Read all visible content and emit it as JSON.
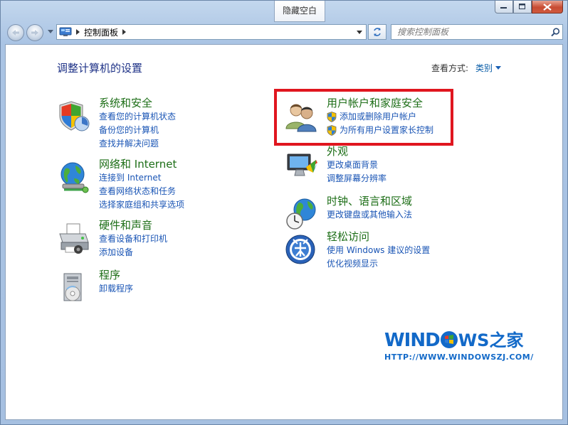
{
  "window": {
    "tooltip": "隐藏空白",
    "buttons": [
      "minimize",
      "maximize",
      "close"
    ]
  },
  "toolbar": {
    "breadcrumb": "控制面板",
    "search_placeholder": "搜索控制面板"
  },
  "main": {
    "title": "调整计算机的设置",
    "view_by_label": "查看方式:",
    "view_by_value": "类别"
  },
  "categories": [
    {
      "title": "系统和安全",
      "icon": "shield-icon",
      "links": [
        "查看您的计算机状态",
        "备份您的计算机",
        "查找并解决问题"
      ]
    },
    {
      "title": "网络和 Internet",
      "icon": "network-icon",
      "links": [
        "连接到 Internet",
        "查看网络状态和任务",
        "选择家庭组和共享选项"
      ]
    },
    {
      "title": "硬件和声音",
      "icon": "printer-icon",
      "links": [
        "查看设备和打印机",
        "添加设备"
      ]
    },
    {
      "title": "程序",
      "icon": "programs-icon",
      "links": [
        "卸载程序"
      ]
    },
    {
      "title": "用户帐户和家庭安全",
      "icon": "users-icon",
      "links": [
        "添加或删除用户帐户",
        "为所有用户设置家长控制"
      ]
    },
    {
      "title": "外观",
      "icon": "appearance-icon",
      "links": [
        "更改桌面背景",
        "调整屏幕分辨率"
      ]
    },
    {
      "title": "时钟、语言和区域",
      "icon": "clock-globe-icon",
      "links": [
        "更改键盘或其他输入法"
      ]
    },
    {
      "title": "轻松访问",
      "icon": "ease-of-access-icon",
      "links": [
        "使用 Windows 建议的设置",
        "优化视频显示"
      ]
    }
  ],
  "watermark": {
    "brand_left": "WIND",
    "brand_right": "WS之家",
    "url": "HTTP://WWW.WINDOWSZJ.COM/"
  },
  "colors": {
    "title_green": "#1d6e17",
    "link_blue": "#1a55b5",
    "highlight_red": "#e0161f",
    "watermark_blue": "#1269c8"
  }
}
